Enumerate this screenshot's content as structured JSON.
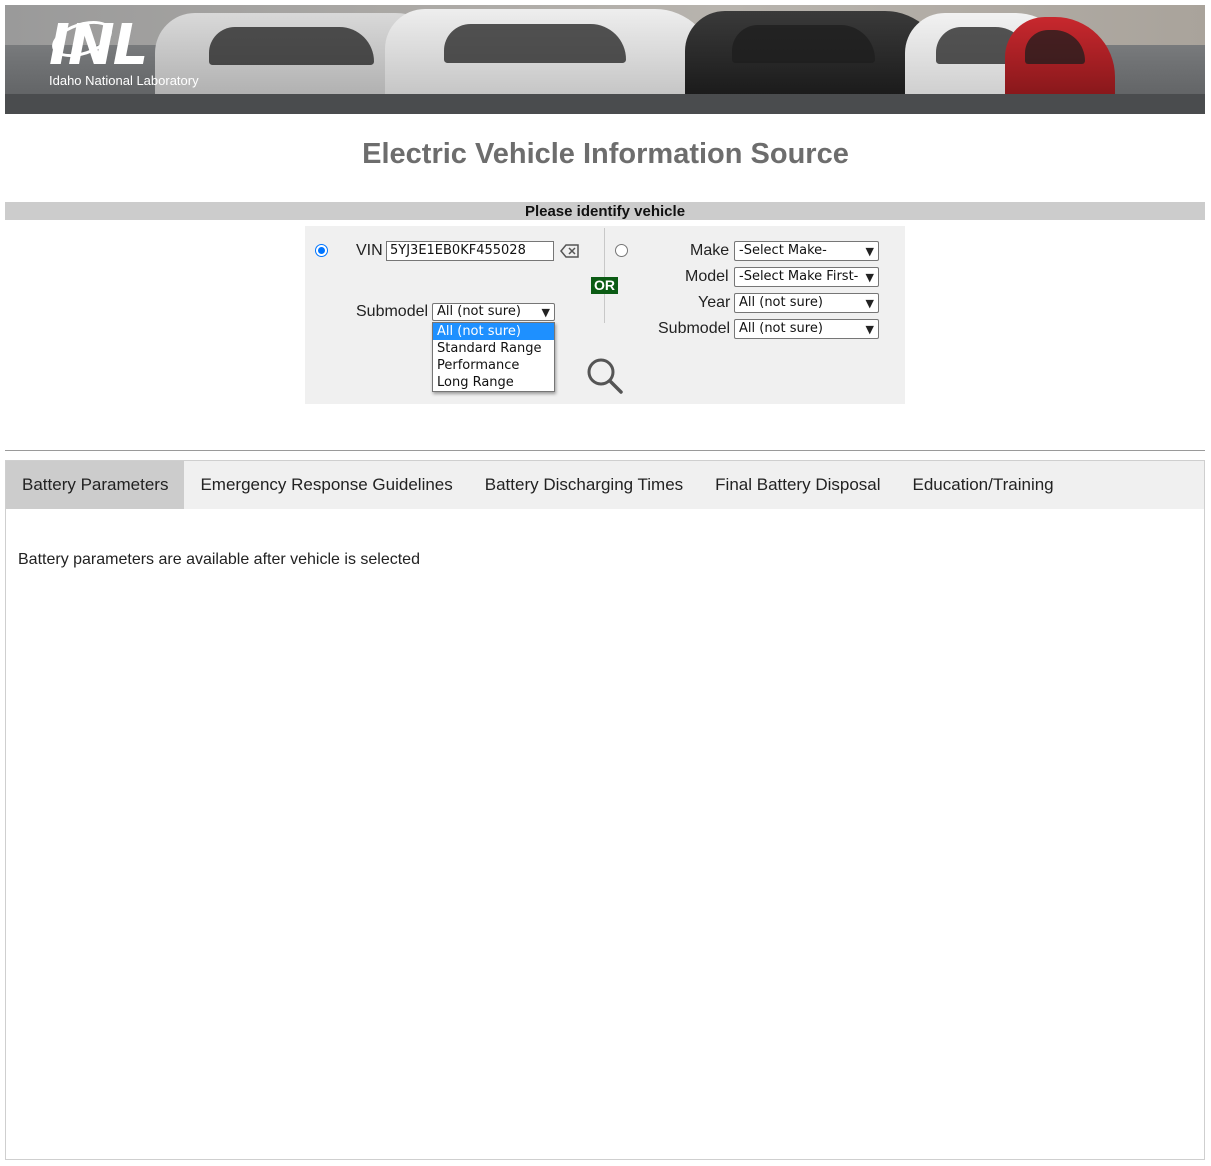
{
  "banner": {
    "logo_mark": "INL",
    "logo_name": "Idaho National Laboratory"
  },
  "page_title": "Electric Vehicle Information Source",
  "identify_heading": "Please identify vehicle",
  "vin_form": {
    "vin_label": "VIN",
    "vin_value": "5YJ3E1EB0KF455028",
    "submodel_label": "Submodel",
    "submodel_selected": "All (not sure)",
    "submodel_options": [
      "All (not sure)",
      "Standard Range",
      "Performance",
      "Long Range"
    ],
    "selected": true
  },
  "or_label": "OR",
  "make_form": {
    "make_label": "Make",
    "make_value": "-Select Make-",
    "model_label": "Model",
    "model_value": "-Select Make First-",
    "year_label": "Year",
    "year_value": "All (not sure)",
    "submodel_label": "Submodel",
    "submodel_value": "All (not sure)",
    "selected": false
  },
  "tabs": [
    {
      "label": "Battery Parameters",
      "active": true
    },
    {
      "label": "Emergency Response Guidelines",
      "active": false
    },
    {
      "label": "Battery Discharging Times",
      "active": false
    },
    {
      "label": "Final Battery Disposal",
      "active": false
    },
    {
      "label": "Education/Training",
      "active": false
    }
  ],
  "content_message": "Battery parameters are available after vehicle is selected",
  "colors": {
    "or_badge": "#0b5b14",
    "highlight": "#1e90ff",
    "radio_accent": "#0075ff",
    "title_gray": "#6d6d6d"
  }
}
